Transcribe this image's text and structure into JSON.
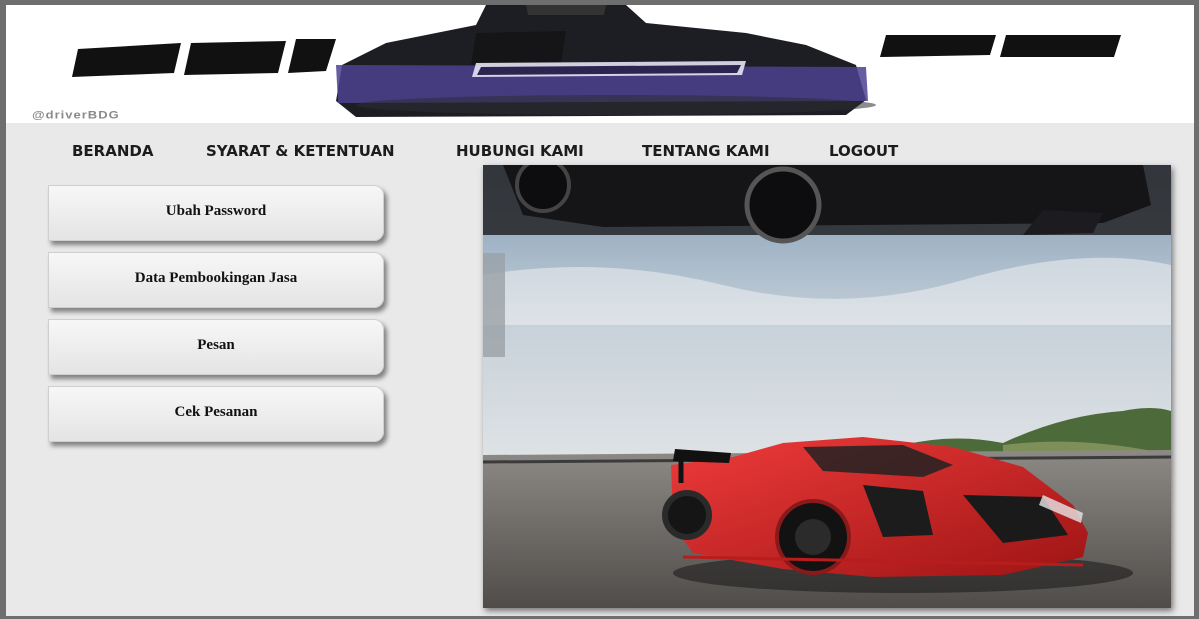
{
  "header": {
    "brand_word": "DRIVER",
    "brand_sub": "BDG",
    "handle": "@driverBDG"
  },
  "nav": {
    "items": [
      "BERANDA",
      "SYARAT & KETENTUAN",
      "HUBUNGI KAMI",
      "TENTANG KAMI",
      "LOGOUT"
    ]
  },
  "menu": {
    "items": [
      "Ubah Password",
      "Data Pembookingan Jasa",
      "Pesan",
      "Cek Pesanan"
    ]
  },
  "colors": {
    "page_bg": "#e9e9e9",
    "banner_purple": "#4a3f8f",
    "car_red": "#d32626"
  },
  "icons": {
    "brand_logo": "driver-bdg-logo",
    "hero_image": "red-supercar-photo"
  }
}
